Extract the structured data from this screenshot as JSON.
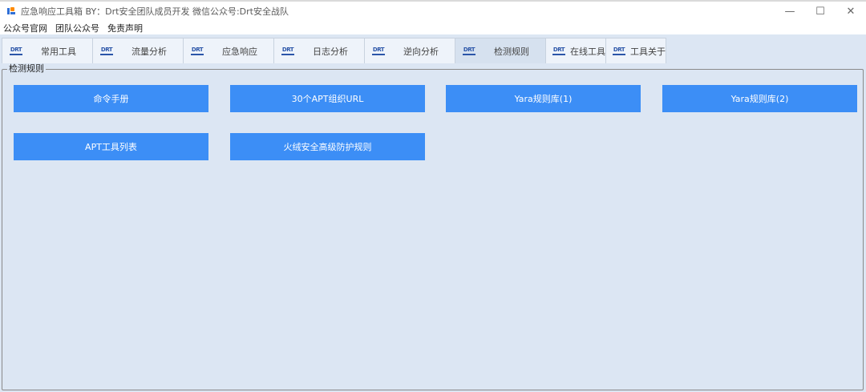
{
  "window": {
    "title": "应急响应工具箱   BY：Drt安全团队成员开发   微信公众号:Drt安全战队",
    "minimize": "—",
    "maximize": "☐",
    "close": "✕"
  },
  "menu": {
    "items": [
      "公众号官网",
      "团队公众号",
      "免责声明"
    ]
  },
  "tabs": {
    "icon_text": "DRT",
    "items": [
      {
        "label": "常用工具"
      },
      {
        "label": "流量分析"
      },
      {
        "label": "应急响应"
      },
      {
        "label": "日志分析"
      },
      {
        "label": "逆向分析"
      },
      {
        "label": "检测规则"
      },
      {
        "label": "在线工具"
      },
      {
        "label": "工具关于"
      }
    ],
    "active": "检测规则"
  },
  "group": {
    "title": "检测规则"
  },
  "buttons": {
    "items": [
      "命令手册",
      "30个APT组织URL",
      "Yara规则库(1)",
      "Yara规则库(2)",
      "APT工具列表",
      "火绒安全高级防护规则"
    ]
  },
  "colors": {
    "button_bg": "#3c8ef6",
    "panel_bg": "#dce6f3",
    "tab_active_bg": "#d6e1ef",
    "icon_blue": "#2b55a8"
  },
  "icons": {
    "app": "app-logo-icon",
    "tab": "drt-logo-icon"
  }
}
